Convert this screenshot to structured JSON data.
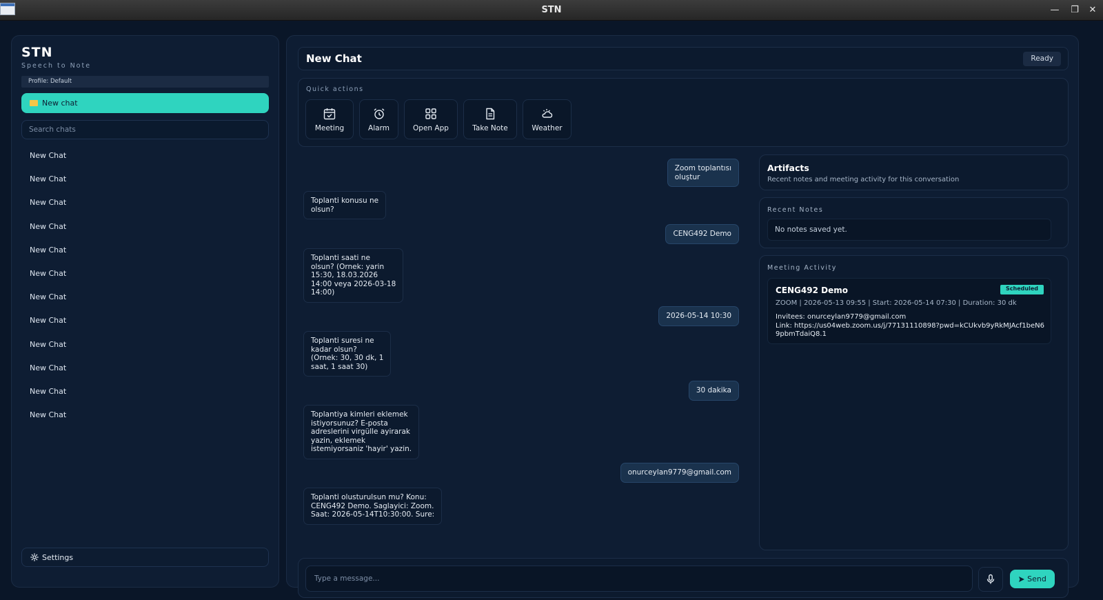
{
  "window": {
    "title": "STN",
    "minimize_glyph": "—",
    "maximize_glyph": "❐",
    "close_glyph": "✕"
  },
  "sidebar": {
    "brand": "STN",
    "tagline": "Speech to Note",
    "profile": "Profile: Default",
    "new_chat_label": "New chat",
    "search_placeholder": "Search chats",
    "chats": [
      "New Chat",
      "New Chat",
      "New Chat",
      "New Chat",
      "New Chat",
      "New Chat",
      "New Chat",
      "New Chat",
      "New Chat",
      "New Chat",
      "New Chat",
      "New Chat"
    ],
    "settings_label": "Settings"
  },
  "header": {
    "title": "New Chat",
    "status": "Ready"
  },
  "quick_actions": {
    "label": "Quick actions",
    "items": [
      {
        "label": "Meeting",
        "icon": "calendar-icon"
      },
      {
        "label": "Alarm",
        "icon": "alarm-clock-icon"
      },
      {
        "label": "Open App",
        "icon": "grid-icon"
      },
      {
        "label": "Take Note",
        "icon": "note-icon"
      },
      {
        "label": "Weather",
        "icon": "weather-icon"
      }
    ]
  },
  "messages": [
    {
      "role": "user",
      "lines": [
        "Zoom toplantısı",
        "oluştur"
      ]
    },
    {
      "role": "bot",
      "lines": [
        "Toplanti konusu ne",
        "olsun?"
      ]
    },
    {
      "role": "user",
      "lines": [
        "CENG492 Demo"
      ]
    },
    {
      "role": "bot",
      "lines": [
        "Toplanti saati ne",
        "olsun? (Ornek: yarin",
        "15:30, 18.03.2026",
        "14:00 veya 2026-03-18",
        "14:00)"
      ]
    },
    {
      "role": "user",
      "lines": [
        "2026-05-14 10:30"
      ]
    },
    {
      "role": "bot",
      "lines": [
        "Toplanti suresi ne",
        "kadar olsun?",
        "(Ornek: 30, 30 dk, 1",
        "saat, 1 saat 30)"
      ]
    },
    {
      "role": "user",
      "lines": [
        "30 dakika"
      ]
    },
    {
      "role": "bot",
      "lines": [
        "Toplantiya kimleri eklemek",
        "istiyorsunuz? E-posta",
        "adreslerini virgülle ayirarak",
        "yazin, eklemek",
        "istemiyorsaniz 'hayir' yazin."
      ]
    },
    {
      "role": "user",
      "lines": [
        "onurceylan9779@gmail.com"
      ]
    },
    {
      "role": "bot",
      "lines": [
        "Toplanti olusturulsun mu? Konu:",
        "CENG492 Demo. Saglayici: Zoom.",
        "Saat: 2026-05-14T10:30:00. Sure:"
      ]
    }
  ],
  "artifacts": {
    "title": "Artifacts",
    "subtitle": "Recent notes and meeting activity for this conversation",
    "notes_label": "Recent Notes",
    "notes_empty": "No notes saved yet.",
    "meeting_label": "Meeting Activity",
    "meeting": {
      "title": "CENG492 Demo",
      "badge": "Scheduled",
      "meta": "ZOOM | 2026-05-13 09:55 | Start: 2026-05-14 07:30 | Duration: 30 dk",
      "invitees": "Invitees: onurceylan9779@gmail.com",
      "link": "Link: https://us04web.zoom.us/j/77131110898?pwd=kCUkvb9yRkMJAcf1beN69pbmTdaiQ8.1"
    }
  },
  "composer": {
    "placeholder": "Type a message...",
    "send_label": "Send"
  },
  "colors": {
    "accent": "#2fd4bf",
    "background": "#0a1628",
    "panel": "#0e1d33"
  }
}
